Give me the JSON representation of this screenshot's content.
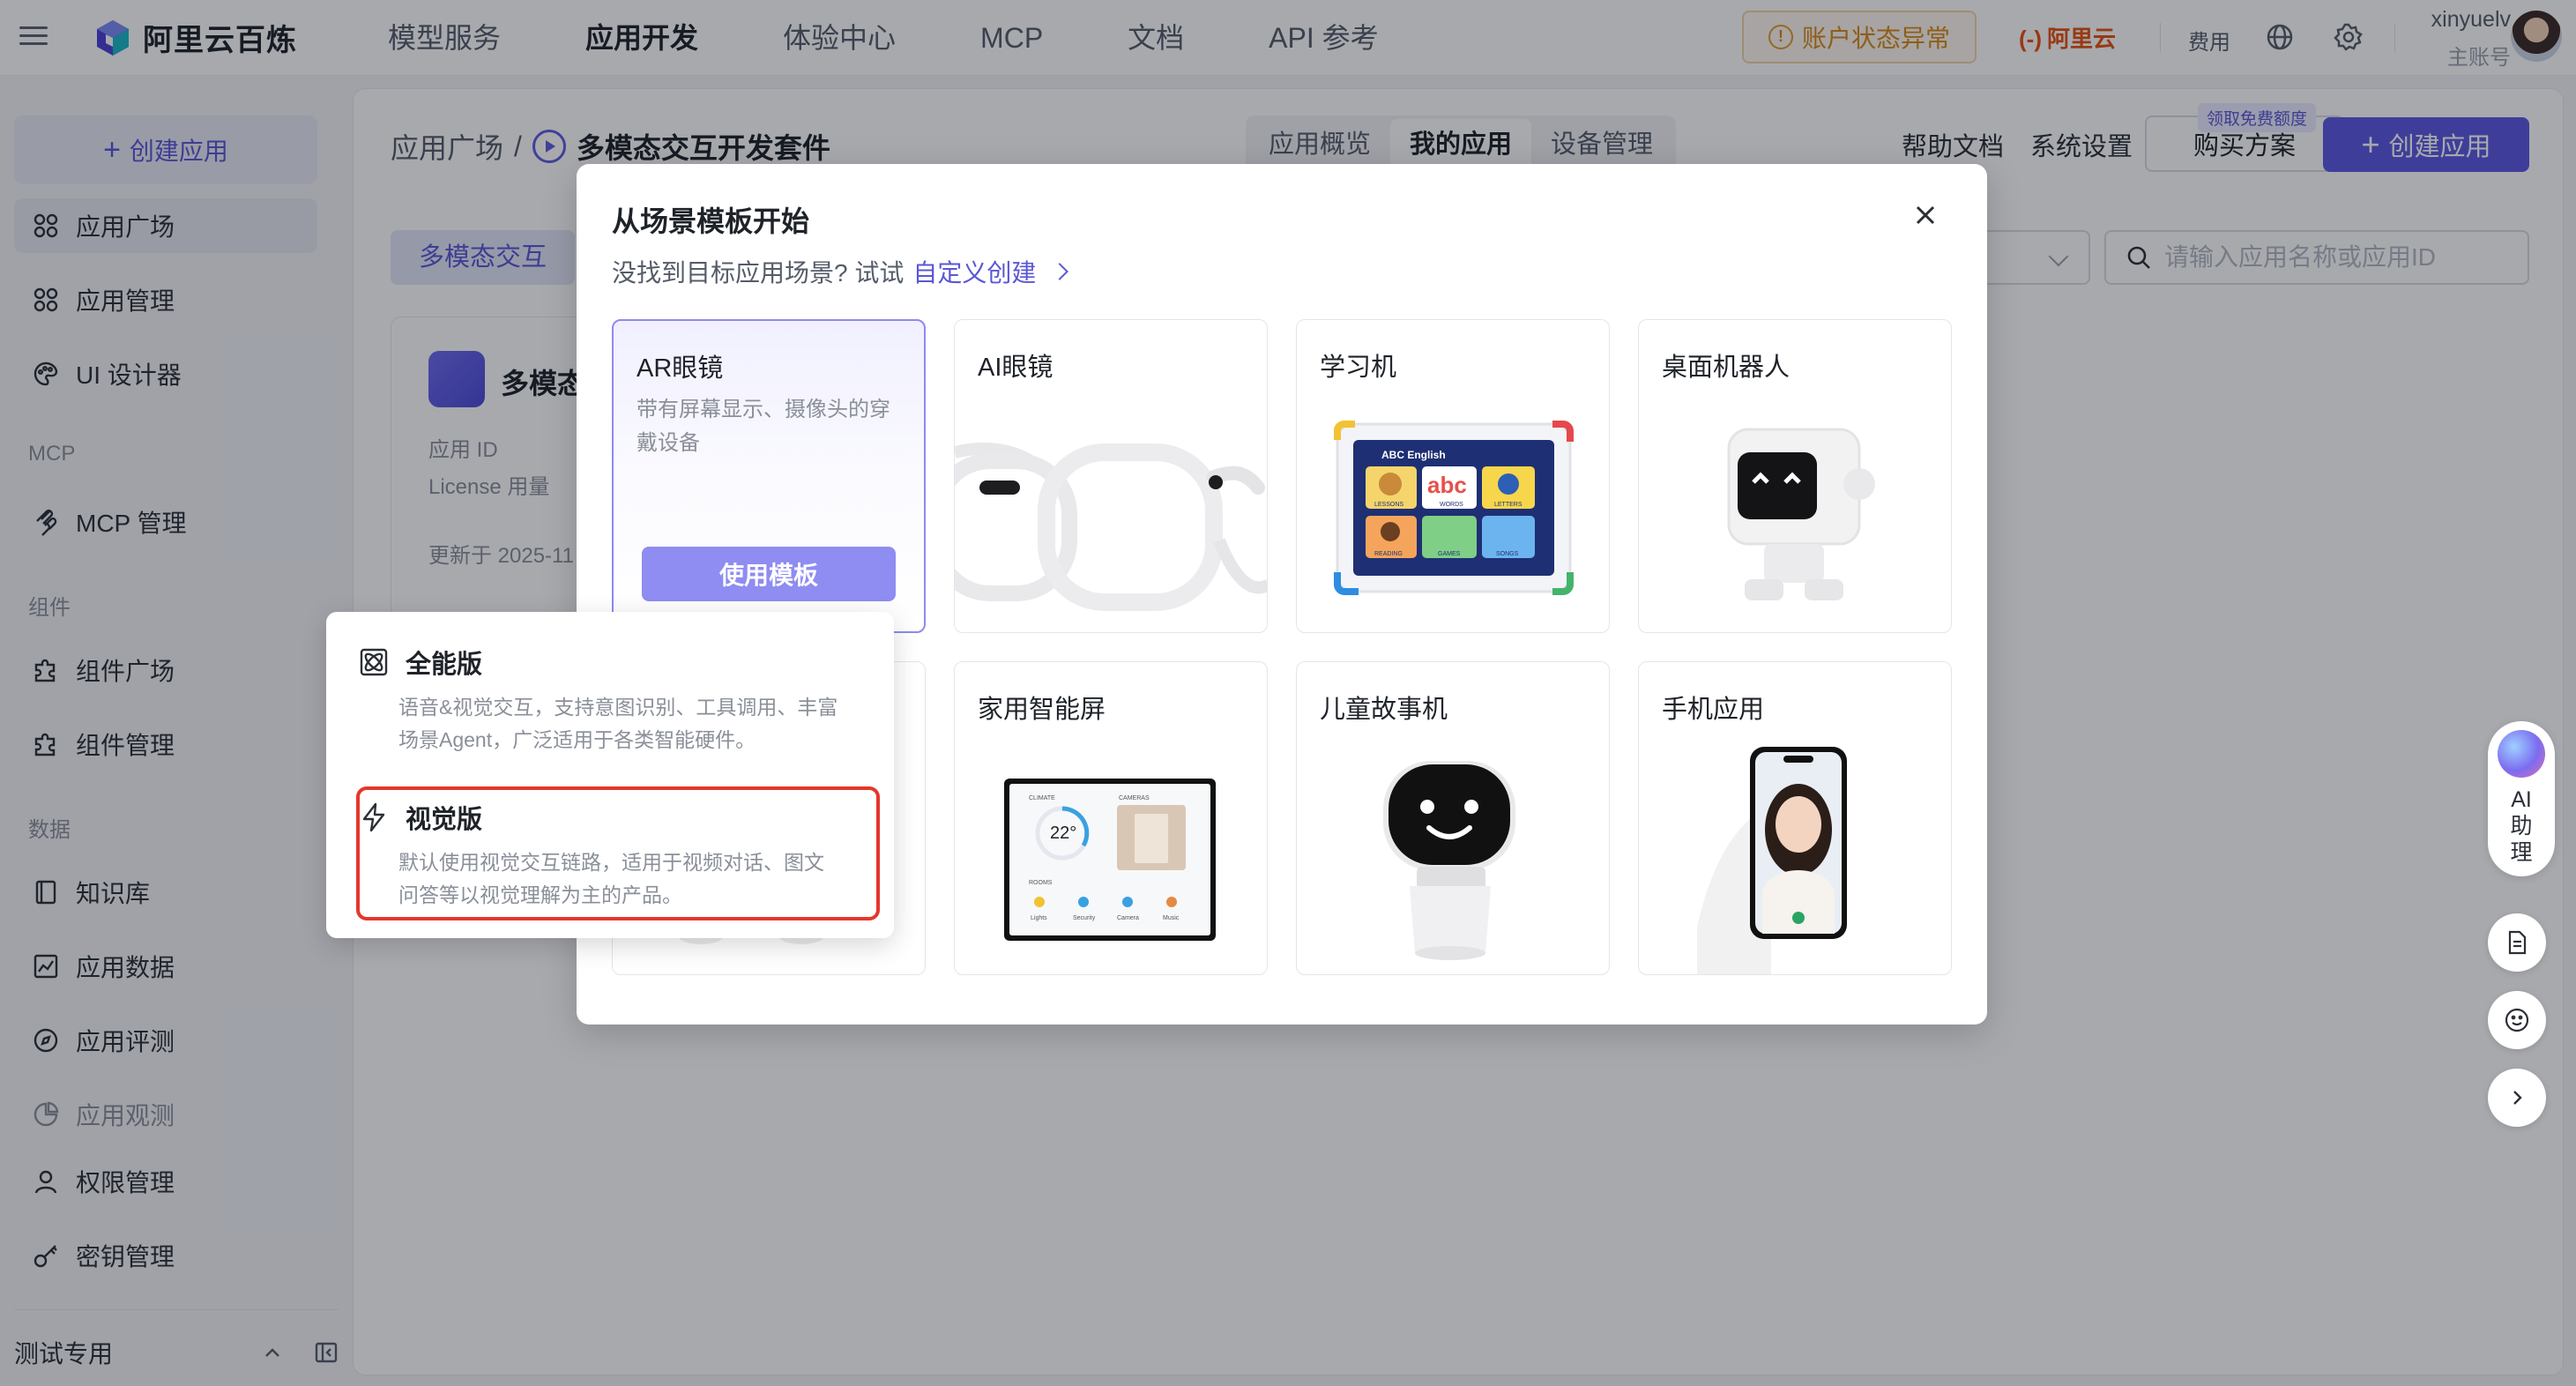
{
  "topbar": {
    "brand": "阿里云百炼",
    "nav": [
      "模型服务",
      "应用开发",
      "体验中心",
      "MCP",
      "文档",
      "API 参考"
    ],
    "active_nav": "应用开发",
    "account_warning": "账户状态异常",
    "aliyun_logo": "阿里云",
    "fee": "费用",
    "user_name": "xinyuelv",
    "user_role": "主账号"
  },
  "sidebar": {
    "create": "创建应用",
    "items_top": [
      {
        "label": "应用广场",
        "icon": "grid-icon"
      },
      {
        "label": "应用管理",
        "icon": "grid-icon"
      },
      {
        "label": "UI 设计器",
        "icon": "palette-icon"
      }
    ],
    "group_mcp": "MCP",
    "mcp_item": "MCP 管理",
    "group_component": "组件",
    "component_items": [
      "组件广场",
      "组件管理"
    ],
    "group_data": "数据",
    "data_items": [
      "知识库",
      "应用数据",
      "应用评测",
      "应用观测",
      "权限管理",
      "密钥管理"
    ],
    "footer": "测试专用"
  },
  "main": {
    "breadcrumb_root": "应用广场",
    "breadcrumb_sep": "/",
    "breadcrumb_current": "多模态交互开发套件",
    "tabs": [
      "应用概览",
      "我的应用",
      "设备管理"
    ],
    "active_tab": "我的应用",
    "help": "帮助文档",
    "settings": "系统设置",
    "buy": "购买方案",
    "buy_tag": "领取免费额度",
    "create": "创建应用",
    "filter_chip": "多模态交互",
    "search_placeholder": "请输入应用名称或应用ID",
    "card_title": "多模态",
    "card_id_label": "应用 ID",
    "card_license_label": "License 用量",
    "card_updated": "更新于 2025-11"
  },
  "modal": {
    "title": "从场景模板开始",
    "subtitle": "没找到目标应用场景? 试试",
    "custom_link": "自定义创建",
    "templates": [
      {
        "name": "AR眼镜",
        "desc": "带有屏幕显示、摄像头的穿戴设备",
        "button": "使用模板"
      },
      {
        "name": "AI眼镜"
      },
      {
        "name": "学习机"
      },
      {
        "name": "桌面机器人"
      },
      {
        "name": ""
      },
      {
        "name": "家用智能屏"
      },
      {
        "name": "儿童故事机"
      },
      {
        "name": "手机应用"
      }
    ],
    "tablet_screen": {
      "header": "ABC English",
      "tiles": [
        "LESSONS",
        "WORDS",
        "LETTERS",
        "READING",
        "GAMES",
        "SONGS"
      ],
      "abc": "abc"
    },
    "smart_screen": {
      "climate": "CLIMATE",
      "temp": "22°",
      "cameras": "CAMERAS",
      "rooms": "ROOMS",
      "devices": [
        "Lights",
        "Security",
        "Camera",
        "Music"
      ]
    }
  },
  "popover": {
    "options": [
      {
        "title": "全能版",
        "desc": "语音&视觉交互，支持意图识别、工具调用、丰富场景Agent，广泛适用于各类智能硬件。",
        "icon": "atom-icon"
      },
      {
        "title": "视觉版",
        "desc": "默认使用视觉交互链路，适用于视频对话、图文问答等以视觉理解为主的产品。",
        "icon": "bolt-icon"
      }
    ],
    "highlighted": "视觉版",
    "highlight_color": "#e5372b"
  },
  "float": {
    "ai_label": "AI助理"
  },
  "colors": {
    "accent": "#5b58e2",
    "warning": "#d88a16",
    "aliyun": "#e8500f"
  }
}
